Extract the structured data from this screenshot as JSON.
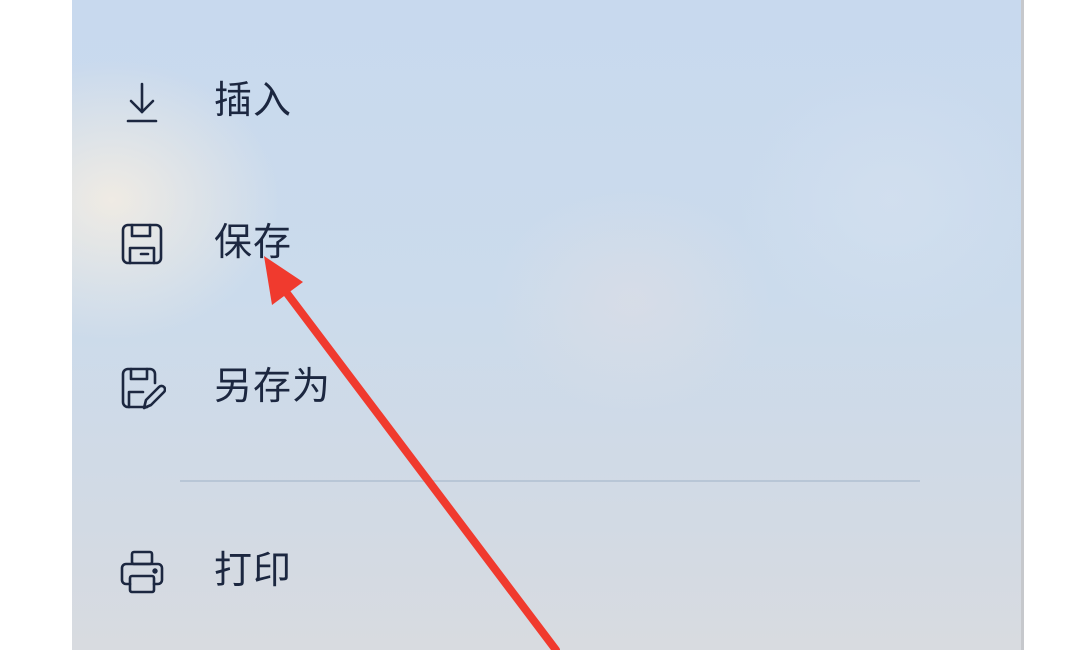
{
  "menu": {
    "items": [
      {
        "id": "insert",
        "label": "插入",
        "icon": "arrow-down-to-line-icon"
      },
      {
        "id": "save",
        "label": "保存",
        "icon": "floppy-disk-icon"
      },
      {
        "id": "saveas",
        "label": "另存为",
        "icon": "floppy-disk-pen-icon"
      },
      {
        "id": "print",
        "label": "打印",
        "icon": "printer-icon"
      }
    ]
  },
  "colors": {
    "text": "#1c2740",
    "icon": "#1c2740",
    "annotation_arrow": "#f03a2e",
    "separator": "#b8c6d6"
  }
}
